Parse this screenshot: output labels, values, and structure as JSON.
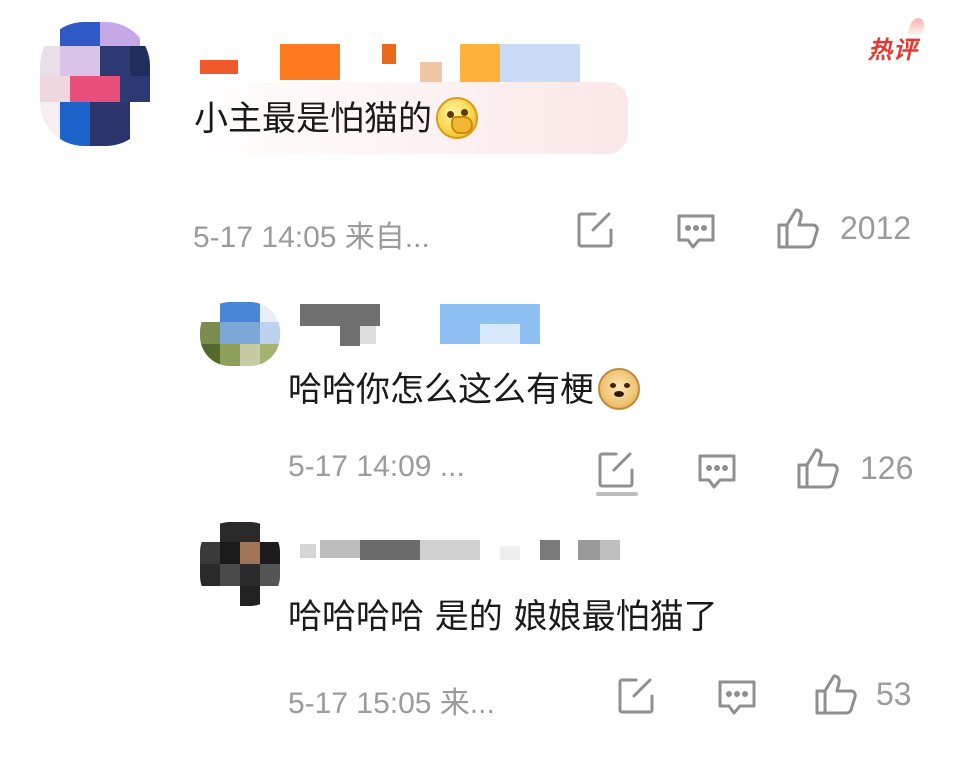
{
  "hot_badge": "热评",
  "comments": [
    {
      "text": "小主最是怕猫的",
      "emoji": "thinking-face-emoji",
      "meta": "5-17 14:05  来自...",
      "like_count": "2012"
    },
    {
      "text": "哈哈你怎么这么有梗",
      "emoji": "doge-emoji",
      "meta": "5-17 14:09  ...",
      "like_count": "126"
    },
    {
      "text": "哈哈哈哈 是的 娘娘最怕猫了",
      "emoji": "",
      "meta": "5-17 15:05  来...",
      "like_count": "53"
    }
  ],
  "colors": {
    "hot_badge": "#e5392f",
    "meta_text": "#9b9b9b",
    "icon": "#8f8f8f"
  }
}
